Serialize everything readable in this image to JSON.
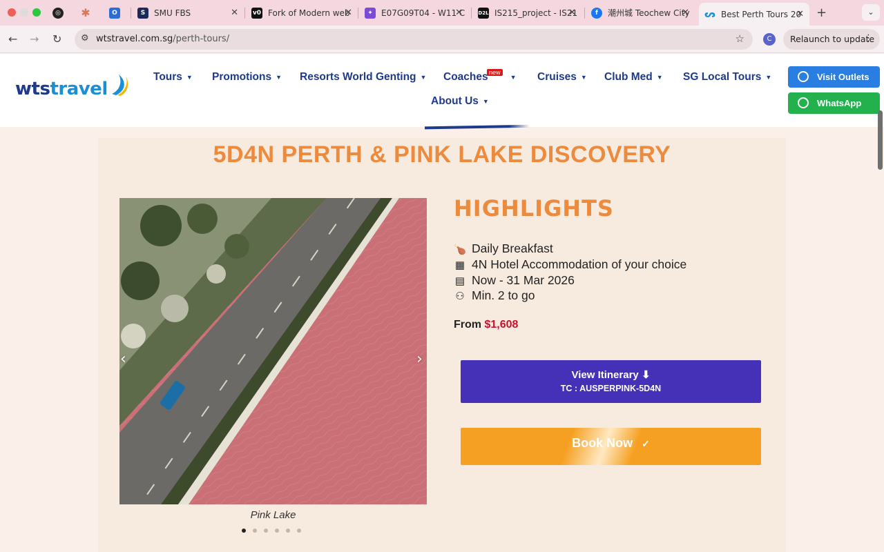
{
  "browser": {
    "tabs": [
      {
        "title": "",
        "icon": "openai-icon"
      },
      {
        "title": "",
        "icon": "claude-icon"
      },
      {
        "title": "",
        "icon": "outlook-icon"
      },
      {
        "title": "SMU FBS",
        "icon": "smu-icon"
      },
      {
        "title": "Fork of Modern web",
        "icon": "v0-icon"
      },
      {
        "title": "E07G09T04 - W11 C",
        "icon": "app-icon"
      },
      {
        "title": "IS215_project - IS21",
        "icon": "d2l-icon"
      },
      {
        "title": "潮州城 Teochew City",
        "icon": "facebook-icon"
      },
      {
        "title": "Best Perth Tours 20",
        "icon": "wts-icon"
      }
    ],
    "url_domain": "wtstravel.com.sg",
    "url_path": "/perth-tours/",
    "profile_initial": "C",
    "relaunch_label": "Relaunch to update"
  },
  "header": {
    "logo_part1": "wts",
    "logo_part2": "travel",
    "menu": [
      "Tours",
      "Promotions",
      "Resorts World Genting",
      "Coaches",
      "Cruises",
      "Club Med",
      "SG Local Tours",
      "About Us"
    ],
    "coaches_badge": "new",
    "visit_outlets": "Visit Outlets",
    "whatsapp": "WhatsApp"
  },
  "tour": {
    "title": "5D4N PERTH & PINK LAKE DISCOVERY",
    "image_caption": "Pink Lake",
    "highlights_title": "HIGHLIGHTS",
    "highlights": [
      {
        "icon": "drumstick-icon",
        "text": "Daily Breakfast"
      },
      {
        "icon": "hotel-icon",
        "text": "4N Hotel Accommodation of your choice"
      },
      {
        "icon": "calendar-icon",
        "text": "Now - 31 Mar 2026"
      },
      {
        "icon": "people-icon",
        "text": "Min. 2 to go"
      }
    ],
    "price_label": "From",
    "price_value": "$1,608",
    "itinerary_label": "View Itinerary",
    "tour_code": "TC : AUSPERPINK-5D4N",
    "book_label": "Book Now"
  },
  "colors": {
    "accent_orange": "#ec8b3d",
    "nav_blue": "#1e3a8a",
    "itinerary_purple": "#4431b8",
    "book_orange": "#f5a022",
    "price_red": "#c8102e"
  }
}
